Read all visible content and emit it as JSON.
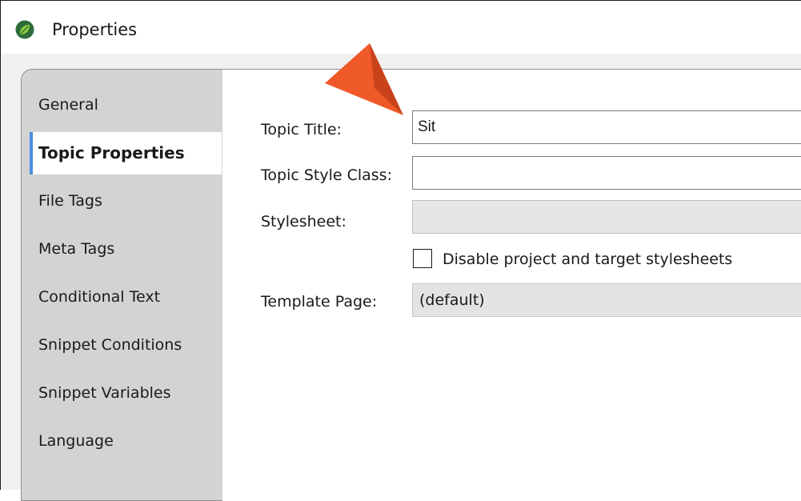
{
  "window": {
    "title": "Properties",
    "app_icon": "leaf-logo-icon"
  },
  "sidebar": {
    "items": [
      {
        "label": "General",
        "active": false
      },
      {
        "label": "Topic Properties",
        "active": true
      },
      {
        "label": "File Tags",
        "active": false
      },
      {
        "label": "Meta Tags",
        "active": false
      },
      {
        "label": "Conditional Text",
        "active": false
      },
      {
        "label": "Snippet Conditions",
        "active": false
      },
      {
        "label": "Snippet Variables",
        "active": false
      },
      {
        "label": "Language",
        "active": false
      }
    ]
  },
  "form": {
    "topic_title": {
      "label": "Topic Title:",
      "value": "Sit"
    },
    "topic_style_class": {
      "label": "Topic Style Class:",
      "value": ""
    },
    "stylesheet": {
      "label": "Stylesheet:",
      "value": "",
      "enabled": false
    },
    "disable_stylesheets": {
      "label": "Disable project and target stylesheets",
      "checked": false
    },
    "template_page": {
      "label": "Template Page:",
      "value": "(default)"
    }
  },
  "annotation": {
    "icon": "callout-arrow-icon",
    "color": "#f05a28"
  },
  "colors": {
    "active_tab_accent": "#4a90e2",
    "sidebar_bg": "#d3d3d3"
  }
}
